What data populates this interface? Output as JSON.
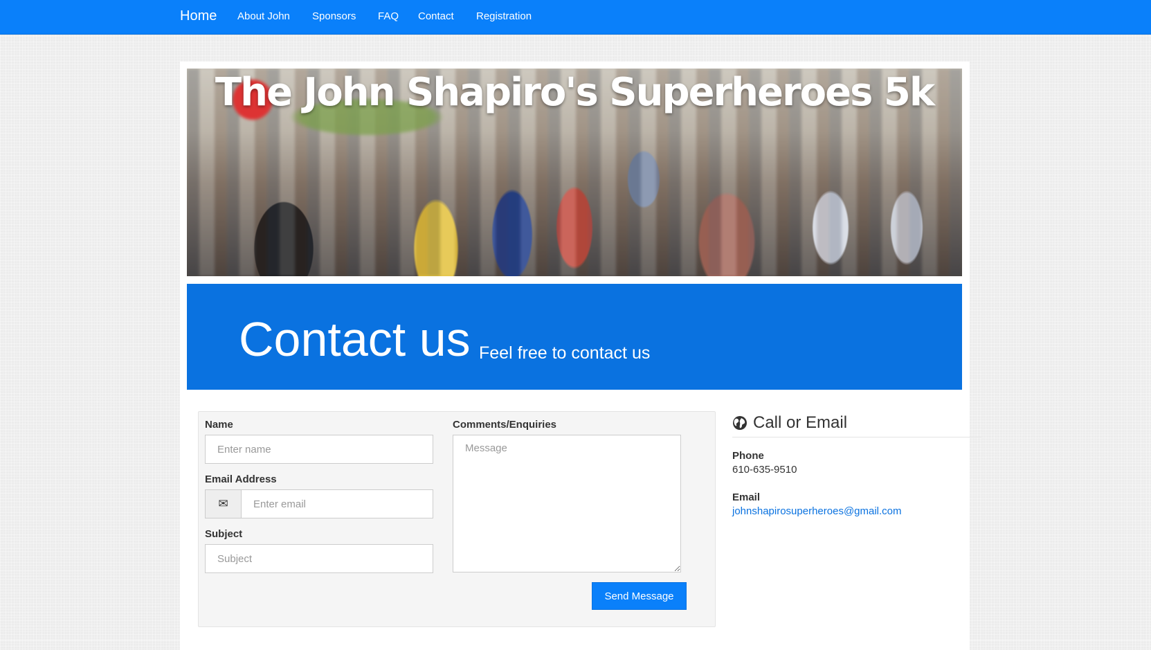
{
  "nav": {
    "brand": "Home",
    "links": [
      "About John",
      "Sponsors",
      "FAQ",
      "Contact",
      "Registration"
    ]
  },
  "banner": {
    "title": "The John Shapiro's Superheroes 5k"
  },
  "jumbotron": {
    "title": "Contact us",
    "subtitle": "Feel free to contact us"
  },
  "form": {
    "name_label": "Name",
    "name_placeholder": "Enter name",
    "email_label": "Email Address",
    "email_placeholder": "Enter email",
    "email_icon": "envelope-icon",
    "subject_label": "Subject",
    "subject_placeholder": "Subject",
    "comments_label": "Comments/Enquiries",
    "message_placeholder": "Message",
    "submit_label": "Send Message"
  },
  "contact_info": {
    "title": "Call or Email",
    "icon": "globe-icon",
    "phone_label": "Phone",
    "phone_value": "610-635-9510",
    "email_label": "Email",
    "email_value": "johnshapirosuperheroes@gmail.com"
  },
  "colors": {
    "primary": "#0a80fa",
    "jumbotron": "#0a72e0",
    "link": "#0a72e0"
  }
}
